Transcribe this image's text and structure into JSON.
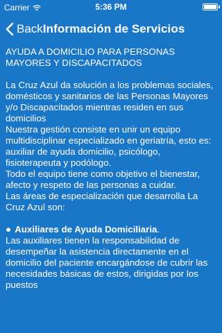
{
  "status_bar": {
    "carrier": "Carrier",
    "time": "5:36 PM",
    "battery_level": 1.0
  },
  "nav": {
    "back_label": "Back",
    "title": "Información de Servicios"
  },
  "content": {
    "heading": "AYUDA A DOMICILIO PARA PERSONAS MAYORES Y DISCAPACITADOS",
    "body": "La Cruz Azul da solución a los problemas sociales, domésticos y sanitarios de las Personas Mayores y/o Discapacitados mientras residen en sus domicilios\nNuestra gestión consiste en unir un equipo multidisciplinar especializado en geriatría, esto es:\nauxiliar de ayuda domicilio, psicólogo, fisioterapeuta y podólogo.\nTodo el equipo tiene como objetivo el bienestar, afecto y respeto de las personas a cuidar.\nLas áreas de especialización que desarrolla La Cruz Azul son:",
    "bullet": {
      "marker": "●",
      "title": "Auxiliares de Ayuda Domiciliaria",
      "title_suffix": ".",
      "text": "Las auxiliares tienen la responsabilidad de desempeñar la asistencia directamente en el domicilio del paciente encargándose de cubrir las necesidades básicas de estos, dirigidas por los puestos"
    }
  },
  "icons": {
    "back": "chevron-left-icon",
    "wifi": "wifi-icon",
    "battery": "battery-icon"
  },
  "colors": {
    "background": "#1a76c7",
    "text": "#ffffff"
  }
}
